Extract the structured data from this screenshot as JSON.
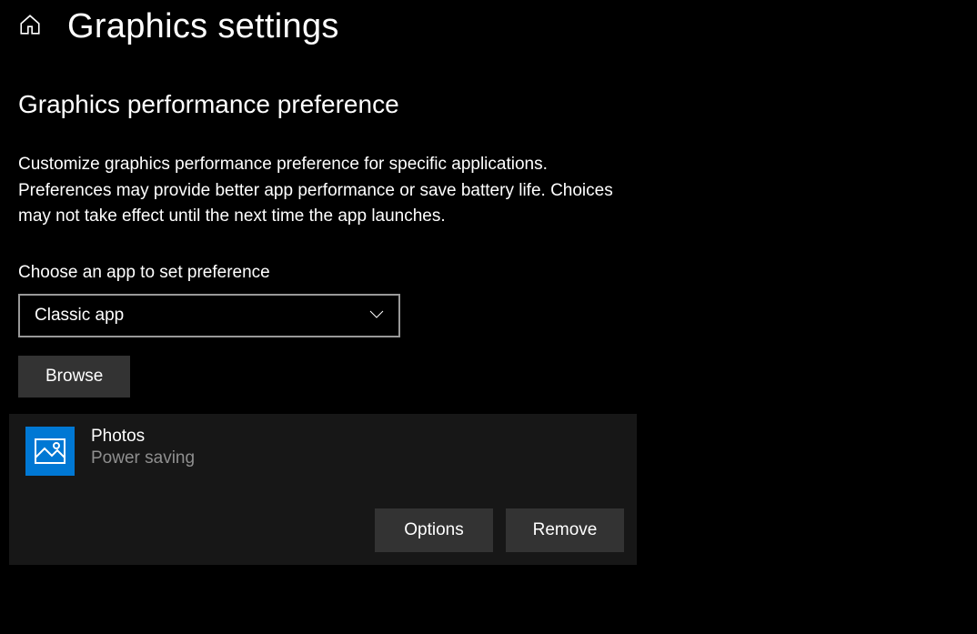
{
  "header": {
    "title": "Graphics settings"
  },
  "main": {
    "heading": "Graphics performance preference",
    "description": "Customize graphics performance preference for specific applications. Preferences may provide better app performance or save battery life. Choices may not take effect until the next time the app launches.",
    "dropdown_label": "Choose an app to set preference",
    "dropdown_value": "Classic app",
    "browse_label": "Browse"
  },
  "app": {
    "name": "Photos",
    "status": "Power saving",
    "options_label": "Options",
    "remove_label": "Remove"
  }
}
